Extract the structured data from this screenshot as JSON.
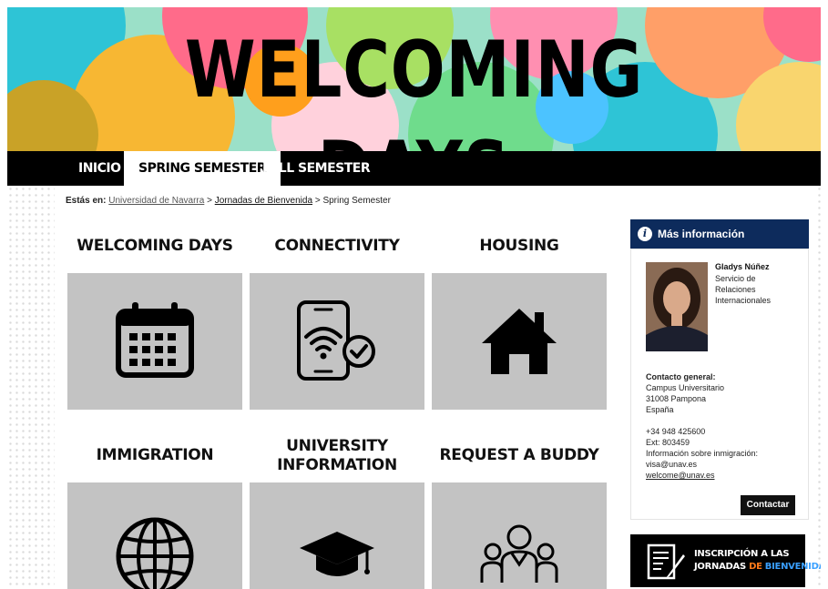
{
  "banner": {
    "title": "WELCOMING DAYS"
  },
  "nav": {
    "items": [
      {
        "label": "INICIO",
        "active": false
      },
      {
        "label": "SPRING SEMESTER",
        "active": true
      },
      {
        "label": "FALL SEMESTER",
        "active": false
      }
    ]
  },
  "breadcrumb": {
    "prefix": "Estás en:",
    "items": [
      "Universidad de Navarra",
      "Jornadas de Bienvenida",
      "Spring Semester"
    ],
    "separator": ">"
  },
  "tiles": [
    {
      "title_line1": "WELCOMING DAYS",
      "title_line2": "",
      "icon": "calendar-icon"
    },
    {
      "title_line1": "CONNECTIVITY",
      "title_line2": "",
      "icon": "smartphone-wifi-icon"
    },
    {
      "title_line1": "HOUSING",
      "title_line2": "",
      "icon": "house-icon"
    },
    {
      "title_line1": "IMMIGRATION",
      "title_line2": "",
      "icon": "globe-icon"
    },
    {
      "title_line1": "UNIVERSITY",
      "title_line2": "INFORMATION",
      "icon": "graduation-cap-icon"
    },
    {
      "title_line1": "REQUEST A BUDDY",
      "title_line2": "",
      "icon": "people-group-icon"
    }
  ],
  "sidebar": {
    "header": "Más información",
    "person": {
      "name": "Gladys Núñez",
      "role_line1": "Servicio de",
      "role_line2": "Relaciones",
      "role_line3": "Internacionales"
    },
    "contact": {
      "label": "Contacto general:",
      "address1": "Campus Universitario",
      "address2": "31008 Pampona",
      "country": "España",
      "phone": "+34 948 425600",
      "ext": "Ext: 803459",
      "immigration_label": "Información sobre inmigración:",
      "immigration_email": "visa@unav.es",
      "welcome_email": "welcome@unav.es"
    },
    "button": "Contactar"
  },
  "promo": {
    "line1": "INSCRIPCIÓN A LAS",
    "line2_a": "JORNADAS",
    "line2_b": "DE",
    "line2_c": "BIENVENIDA"
  },
  "colors": {
    "nav_bg": "#000000",
    "tile_bg": "#c3c3c3",
    "sidebar_header": "#0d2b5c",
    "promo_orange": "#ff7a1a",
    "promo_blue": "#3aa0ff"
  }
}
